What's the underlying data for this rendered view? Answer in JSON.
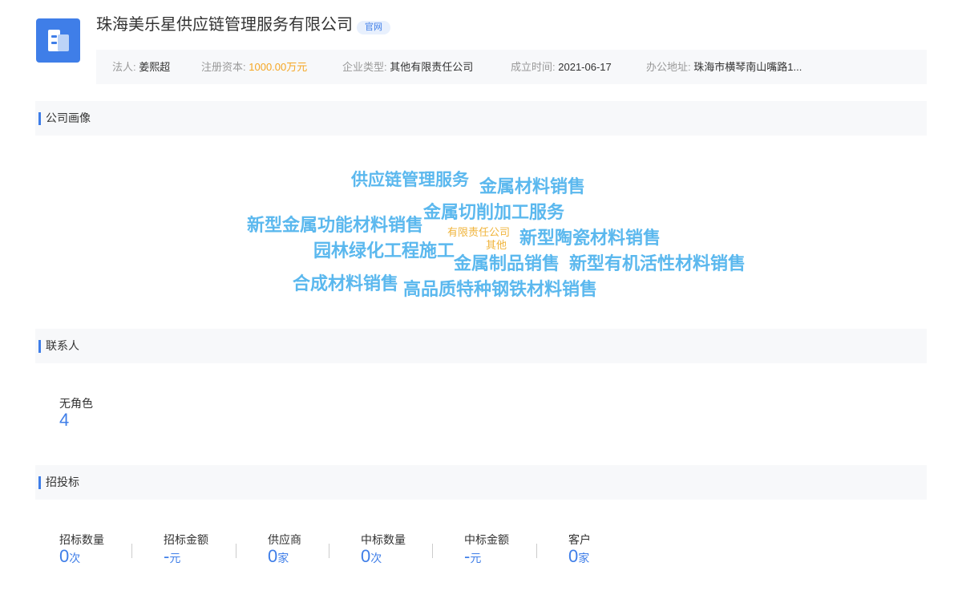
{
  "company": {
    "logo_icon": "building-icon",
    "name": "珠海美乐星供应链管理服务有限公司",
    "badge": "官网"
  },
  "info": {
    "legal_label": "法人:",
    "legal_value": "姜熙超",
    "capital_label": "注册资本:",
    "capital_value": "1000.00万元",
    "type_label": "企业类型:",
    "type_value": "其他有限责任公司",
    "date_label": "成立时间:",
    "date_value": "2021-06-17",
    "address_label": "办公地址:",
    "address_value": "珠海市横琴南山嘴路1..."
  },
  "sections": {
    "profile": "公司画像",
    "contacts": "联系人",
    "bidding": "招投标"
  },
  "word_cloud": [
    {
      "text": "供应链管理服务",
      "color": "#5bb8ee"
    },
    {
      "text": "金属材料销售",
      "color": "#5bb8ee"
    },
    {
      "text": "金属切削加工服务",
      "color": "#5bb8ee"
    },
    {
      "text": "新型金属功能材料销售",
      "color": "#5bb8ee"
    },
    {
      "text": "有限责任公司",
      "color": "#f0b43c"
    },
    {
      "text": "新型陶瓷材料销售",
      "color": "#5bb8ee"
    },
    {
      "text": "其他",
      "color": "#f0b43c"
    },
    {
      "text": "园林绿化工程施工",
      "color": "#5bb8ee"
    },
    {
      "text": "金属制品销售",
      "color": "#5bb8ee"
    },
    {
      "text": "新型有机活性材料销售",
      "color": "#5bb8ee"
    },
    {
      "text": "合成材料销售",
      "color": "#5bb8ee"
    },
    {
      "text": "高品质特种钢铁材料销售",
      "color": "#5bb8ee"
    }
  ],
  "contacts": {
    "role_label": "无角色",
    "role_count": "4"
  },
  "bidding": {
    "stats": [
      {
        "label": "招标数量",
        "value": "0",
        "unit": "次"
      },
      {
        "label": "招标金额",
        "value": "-",
        "unit": "元"
      },
      {
        "label": "供应商",
        "value": "0",
        "unit": "家"
      },
      {
        "label": "中标数量",
        "value": "0",
        "unit": "次"
      },
      {
        "label": "中标金额",
        "value": "-",
        "unit": "元"
      },
      {
        "label": "客户",
        "value": "0",
        "unit": "家"
      }
    ]
  }
}
